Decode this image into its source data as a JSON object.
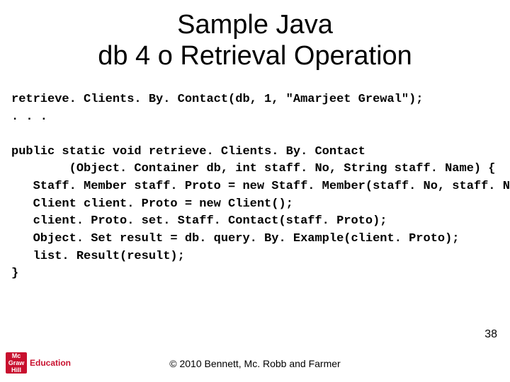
{
  "title_line1": "Sample Java",
  "title_line2": "db 4 o Retrieval Operation",
  "code_block_1": "retrieve. Clients. By. Contact(db, 1, \"Amarjeet Grewal\");\n. . .",
  "code_block_2": "public static void retrieve. Clients. By. Contact\n        (Object. Container db, int staff. No, String staff. Name) {\n   Staff. Member staff. Proto = new Staff. Member(staff. No, staff. Name);\n   Client client. Proto = new Client();\n   client. Proto. set. Staff. Contact(staff. Proto);\n   Object. Set result = db. query. By. Example(client. Proto);\n   list. Result(result);\n}",
  "slide_number": "38",
  "copyright": "© 2010 Bennett, Mc. Robb and Farmer",
  "logo": {
    "badge_top": "Mc",
    "badge_mid": "Graw",
    "badge_bot": "Hill",
    "text": "Education"
  }
}
